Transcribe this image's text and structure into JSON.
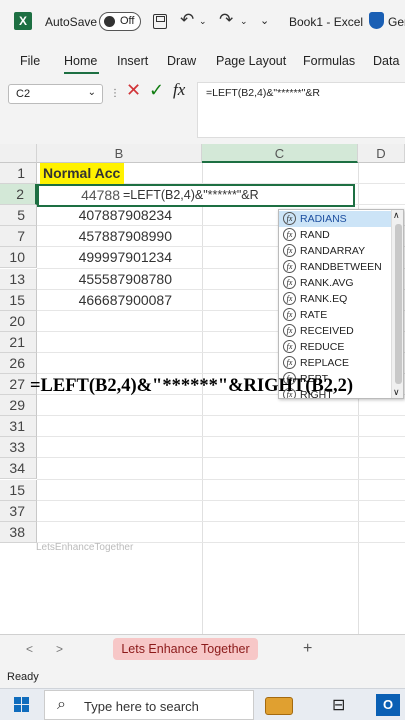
{
  "titlebar": {
    "app_icon": "excel-logo",
    "autosave_label": "AutoSave",
    "autosave_state": "Off",
    "undo_glyph": "↶",
    "redo_glyph": "↷",
    "book_title": "Book1 - Excel",
    "account_label": "Ger"
  },
  "ribbon": {
    "tabs": [
      "File",
      "Home",
      "Insert",
      "Draw",
      "Page Layout",
      "Formulas",
      "Data"
    ],
    "active_tab": "Home"
  },
  "formula_bar": {
    "name_box": "C2",
    "formula": "=LEFT(B2,4)&\"******\"&R"
  },
  "sheet": {
    "columns": [
      "B",
      "C",
      "D"
    ],
    "rows": [
      "1",
      "2",
      "5",
      "7",
      "10",
      "13",
      "15",
      "20",
      "21",
      "26",
      "27",
      "29",
      "31",
      "33",
      "34",
      "15",
      "37",
      "38"
    ],
    "header_cell": "Normal Acc",
    "editing_prefix": "44788",
    "editing_text": "=LEFT(B2,4)&\"******\"&R",
    "values": [
      "407887908234",
      "457887908990",
      "499997901234",
      "455587908780",
      "466687900087"
    ]
  },
  "autocomplete": {
    "items": [
      "RADIANS",
      "RAND",
      "RANDARRAY",
      "RANDBETWEEN",
      "RANK.AVG",
      "RANK.EQ",
      "RATE",
      "RECEIVED",
      "REDUCE",
      "REPLACE",
      "REPT",
      "RIGHT"
    ],
    "selected": "RADIANS"
  },
  "overlay": {
    "big_formula": "=LEFT(B2,4)&\"******\"&RIGHT(B2,2)",
    "watermark": "LetsEnhanceTogether"
  },
  "sheet_tabs": {
    "active": "Lets Enhance Together",
    "add_label": "+"
  },
  "status": {
    "ready": "Ready"
  },
  "taskbar": {
    "search_placeholder": "Type here to search",
    "outlook_label": "O"
  },
  "colors": {
    "excel_green": "#1d6f42",
    "highlight_yellow": "#fff200",
    "tab_pink": "#f7c7c7"
  }
}
